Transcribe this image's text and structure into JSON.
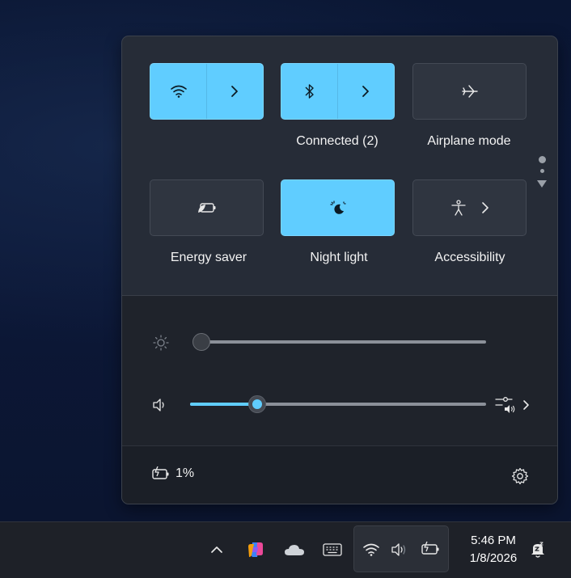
{
  "quick_settings": {
    "tiles": [
      {
        "id": "wifi",
        "label": "",
        "icon": "wifi-icon",
        "state": "on",
        "expandable": true
      },
      {
        "id": "bluetooth",
        "label": "Connected (2)",
        "icon": "bluetooth-icon",
        "state": "on",
        "expandable": true
      },
      {
        "id": "airplane",
        "label": "Airplane mode",
        "icon": "airplane-icon",
        "state": "off",
        "expandable": false
      },
      {
        "id": "energy",
        "label": "Energy saver",
        "icon": "energy-saver-icon",
        "state": "off",
        "expandable": false
      },
      {
        "id": "nightlight",
        "label": "Night light",
        "icon": "night-light-icon",
        "state": "on",
        "expandable": false
      },
      {
        "id": "accessibility",
        "label": "Accessibility",
        "icon": "accessibility-icon",
        "state": "off",
        "expandable": true
      }
    ],
    "brightness": {
      "icon": "brightness-icon",
      "level": 0
    },
    "volume": {
      "icon": "volume-icon",
      "level": 0.23
    },
    "battery": {
      "icon": "battery-charging-icon",
      "text": "1%"
    },
    "settings_icon": "gear-icon"
  },
  "taskbar": {
    "tray_icons": [
      "chevron-up-icon",
      "copilot-icon",
      "onedrive-icon",
      "keyboard-icon"
    ],
    "status_group": [
      "wifi-icon",
      "volume-icon",
      "battery-charging-icon"
    ],
    "time": "5:46 PM",
    "date": "1/8/2026",
    "notification_icon": "notification-bell-icon"
  },
  "colors": {
    "accent": "#60cdff",
    "panel": "#262c37",
    "taskbar": "#1e2128"
  }
}
